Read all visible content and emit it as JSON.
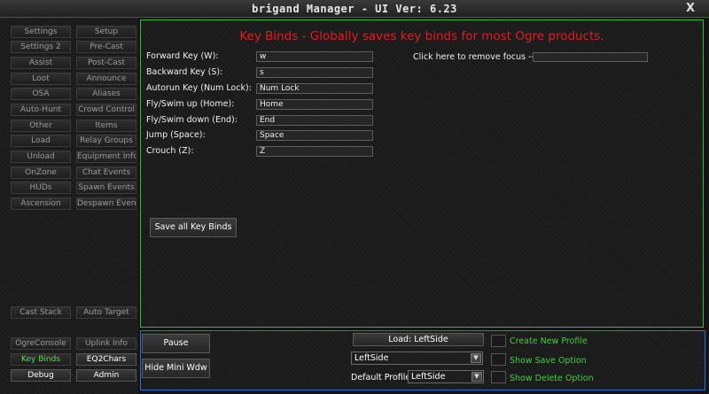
{
  "window": {
    "title": "brigand Manager  - UI Ver: 6.23",
    "close_label": "X"
  },
  "sidebar": {
    "buttons": [
      {
        "label": "Settings"
      },
      {
        "label": "Setup"
      },
      {
        "label": "Settings 2"
      },
      {
        "label": "Pre-Cast"
      },
      {
        "label": "Assist"
      },
      {
        "label": "Post-Cast"
      },
      {
        "label": "Loot"
      },
      {
        "label": "Announce"
      },
      {
        "label": "OSA"
      },
      {
        "label": "Aliases"
      },
      {
        "label": "Auto-Hunt"
      },
      {
        "label": "Crowd Control"
      },
      {
        "label": "Other"
      },
      {
        "label": "Items"
      },
      {
        "label": "Load"
      },
      {
        "label": "Relay Groups"
      },
      {
        "label": "Unload"
      },
      {
        "label": "Equipment Info"
      },
      {
        "label": "OnZone"
      },
      {
        "label": "Chat Events"
      },
      {
        "label": "HUDs"
      },
      {
        "label": "Spawn Events"
      },
      {
        "label": "Ascension"
      },
      {
        "label": "Despawn Event"
      }
    ],
    "cast_stack": "Cast Stack",
    "auto_target": "Auto Target",
    "ogre_console": "OgreConsole",
    "uplink_info": "Uplink Info",
    "key_binds": "Key Binds",
    "eq2chars": "EQ2Chars",
    "debug": "Debug",
    "admin": "Admin"
  },
  "keybinds": {
    "title": "Key Binds - Globally saves key binds for most Ogre products.",
    "rows": [
      {
        "label": "Forward Key (W):",
        "value": "w"
      },
      {
        "label": "Backward Key (S):",
        "value": "s"
      },
      {
        "label": "Autorun Key (Num Lock):",
        "value": "Num Lock"
      },
      {
        "label": "Fly/Swim up (Home):",
        "value": "Home"
      },
      {
        "label": "Fly/Swim down (End):",
        "value": "End"
      },
      {
        "label": "Jump (Space):",
        "value": "Space"
      },
      {
        "label": "Crouch (Z):",
        "value": "Z"
      }
    ],
    "focus_label": "Click here to remove focus ---",
    "focus_value": "",
    "save_label": "Save all Key Binds"
  },
  "bottom": {
    "pause": "Pause",
    "hide_mini": "Hide Mini Wdw",
    "load_label": "Load: LeftSide",
    "profile_select": "LeftSide",
    "default_profile_label": "Default Profile:",
    "default_profile_value": "LeftSide",
    "create_new_profile": "Create New Profile",
    "show_save_option": "Show Save Option",
    "show_delete_option": "Show Delete Option"
  },
  "colors": {
    "accent_green": "#2fbf2f",
    "accent_blue": "#2a6fd6",
    "title_red": "#e01e1e",
    "active_green": "#4de04d"
  }
}
